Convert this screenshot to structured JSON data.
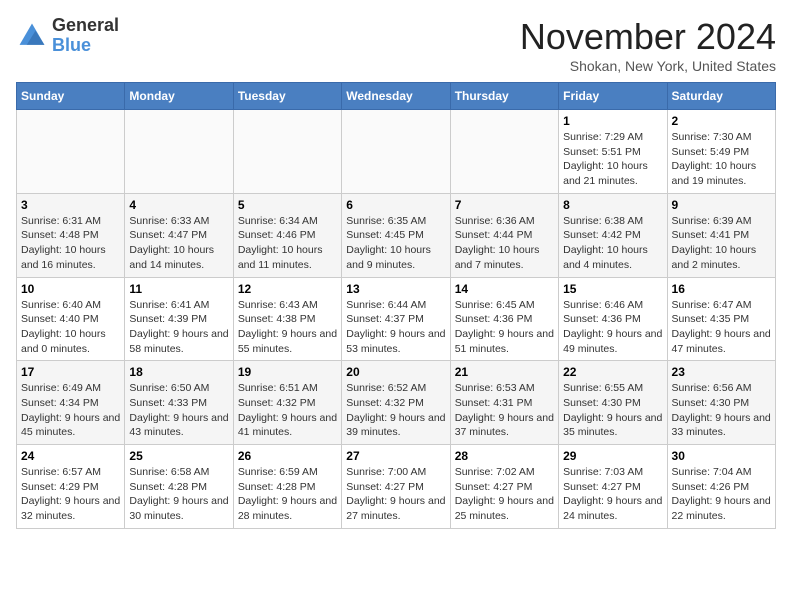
{
  "header": {
    "logo_general": "General",
    "logo_blue": "Blue",
    "month_title": "November 2024",
    "location": "Shokan, New York, United States"
  },
  "weekdays": [
    "Sunday",
    "Monday",
    "Tuesday",
    "Wednesday",
    "Thursday",
    "Friday",
    "Saturday"
  ],
  "weeks": [
    [
      {
        "day": "",
        "info": ""
      },
      {
        "day": "",
        "info": ""
      },
      {
        "day": "",
        "info": ""
      },
      {
        "day": "",
        "info": ""
      },
      {
        "day": "",
        "info": ""
      },
      {
        "day": "1",
        "info": "Sunrise: 7:29 AM\nSunset: 5:51 PM\nDaylight: 10 hours and 21 minutes."
      },
      {
        "day": "2",
        "info": "Sunrise: 7:30 AM\nSunset: 5:49 PM\nDaylight: 10 hours and 19 minutes."
      }
    ],
    [
      {
        "day": "3",
        "info": "Sunrise: 6:31 AM\nSunset: 4:48 PM\nDaylight: 10 hours and 16 minutes."
      },
      {
        "day": "4",
        "info": "Sunrise: 6:33 AM\nSunset: 4:47 PM\nDaylight: 10 hours and 14 minutes."
      },
      {
        "day": "5",
        "info": "Sunrise: 6:34 AM\nSunset: 4:46 PM\nDaylight: 10 hours and 11 minutes."
      },
      {
        "day": "6",
        "info": "Sunrise: 6:35 AM\nSunset: 4:45 PM\nDaylight: 10 hours and 9 minutes."
      },
      {
        "day": "7",
        "info": "Sunrise: 6:36 AM\nSunset: 4:44 PM\nDaylight: 10 hours and 7 minutes."
      },
      {
        "day": "8",
        "info": "Sunrise: 6:38 AM\nSunset: 4:42 PM\nDaylight: 10 hours and 4 minutes."
      },
      {
        "day": "9",
        "info": "Sunrise: 6:39 AM\nSunset: 4:41 PM\nDaylight: 10 hours and 2 minutes."
      }
    ],
    [
      {
        "day": "10",
        "info": "Sunrise: 6:40 AM\nSunset: 4:40 PM\nDaylight: 10 hours and 0 minutes."
      },
      {
        "day": "11",
        "info": "Sunrise: 6:41 AM\nSunset: 4:39 PM\nDaylight: 9 hours and 58 minutes."
      },
      {
        "day": "12",
        "info": "Sunrise: 6:43 AM\nSunset: 4:38 PM\nDaylight: 9 hours and 55 minutes."
      },
      {
        "day": "13",
        "info": "Sunrise: 6:44 AM\nSunset: 4:37 PM\nDaylight: 9 hours and 53 minutes."
      },
      {
        "day": "14",
        "info": "Sunrise: 6:45 AM\nSunset: 4:36 PM\nDaylight: 9 hours and 51 minutes."
      },
      {
        "day": "15",
        "info": "Sunrise: 6:46 AM\nSunset: 4:36 PM\nDaylight: 9 hours and 49 minutes."
      },
      {
        "day": "16",
        "info": "Sunrise: 6:47 AM\nSunset: 4:35 PM\nDaylight: 9 hours and 47 minutes."
      }
    ],
    [
      {
        "day": "17",
        "info": "Sunrise: 6:49 AM\nSunset: 4:34 PM\nDaylight: 9 hours and 45 minutes."
      },
      {
        "day": "18",
        "info": "Sunrise: 6:50 AM\nSunset: 4:33 PM\nDaylight: 9 hours and 43 minutes."
      },
      {
        "day": "19",
        "info": "Sunrise: 6:51 AM\nSunset: 4:32 PM\nDaylight: 9 hours and 41 minutes."
      },
      {
        "day": "20",
        "info": "Sunrise: 6:52 AM\nSunset: 4:32 PM\nDaylight: 9 hours and 39 minutes."
      },
      {
        "day": "21",
        "info": "Sunrise: 6:53 AM\nSunset: 4:31 PM\nDaylight: 9 hours and 37 minutes."
      },
      {
        "day": "22",
        "info": "Sunrise: 6:55 AM\nSunset: 4:30 PM\nDaylight: 9 hours and 35 minutes."
      },
      {
        "day": "23",
        "info": "Sunrise: 6:56 AM\nSunset: 4:30 PM\nDaylight: 9 hours and 33 minutes."
      }
    ],
    [
      {
        "day": "24",
        "info": "Sunrise: 6:57 AM\nSunset: 4:29 PM\nDaylight: 9 hours and 32 minutes."
      },
      {
        "day": "25",
        "info": "Sunrise: 6:58 AM\nSunset: 4:28 PM\nDaylight: 9 hours and 30 minutes."
      },
      {
        "day": "26",
        "info": "Sunrise: 6:59 AM\nSunset: 4:28 PM\nDaylight: 9 hours and 28 minutes."
      },
      {
        "day": "27",
        "info": "Sunrise: 7:00 AM\nSunset: 4:27 PM\nDaylight: 9 hours and 27 minutes."
      },
      {
        "day": "28",
        "info": "Sunrise: 7:02 AM\nSunset: 4:27 PM\nDaylight: 9 hours and 25 minutes."
      },
      {
        "day": "29",
        "info": "Sunrise: 7:03 AM\nSunset: 4:27 PM\nDaylight: 9 hours and 24 minutes."
      },
      {
        "day": "30",
        "info": "Sunrise: 7:04 AM\nSunset: 4:26 PM\nDaylight: 9 hours and 22 minutes."
      }
    ]
  ]
}
